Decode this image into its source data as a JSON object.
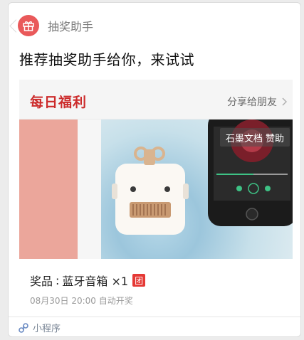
{
  "app": {
    "name": "抽奖助手",
    "icon": "gift-icon",
    "accent": "#e9595a"
  },
  "message": {
    "headline": "推荐抽奖助手给你，来试试"
  },
  "card": {
    "daily_title": "每日福利",
    "share_label": "分享给朋友",
    "sponsor_tag": "石墨文档 赞助",
    "prize_label": "奖品",
    "prize_sep": ":",
    "prize_name": "蓝牙音箱 ×1",
    "group_badge": "团",
    "draw_time": "08月30日 20:00 自动开奖"
  },
  "footer": {
    "label": "小程序",
    "icon": "mini-program-icon"
  }
}
